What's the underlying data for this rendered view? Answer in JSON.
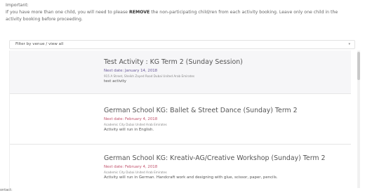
{
  "notice": {
    "heading": "Important:",
    "line1_prefix": "If you have more than one child, you will need to please",
    "line1_bold": "REMOVE",
    "line1_suffix": "the non-participating child/ren from each activity booking. Leave only one child in the",
    "line2": "activity booking before proceeding."
  },
  "filter": {
    "label": "Filter by venue / view all",
    "caret": "▾"
  },
  "activities": [
    {
      "title": "Test Activity : KG Term 2 (Sunday Session)",
      "next_date": "Next date: January 14, 2018",
      "address": "915 A Street, Sheikh Zayed Road Dubai United Arab Emirates",
      "description": "test activity",
      "date_color": "#6a5a9a"
    },
    {
      "title": "German School KG: Ballet & Street Dance (Sunday) Term 2",
      "next_date": "Next date: February 4, 2018",
      "address": "Academic City Dubai United Arab Emirates",
      "description": "Activity will run in English.",
      "date_color": "#c0506a"
    },
    {
      "title": "German School KG: Kreativ-AG/Creative Workshop (Sunday) Term 2",
      "next_date": "Next date: February 4, 2018",
      "address": "Academic City Dubai United Arab Emirates",
      "description": "Activity will run in German. Handcraft work and designing with glue, scissor, paper, pencils.",
      "date_color": "#c0506a"
    }
  ],
  "bottom_label": "ontact:"
}
